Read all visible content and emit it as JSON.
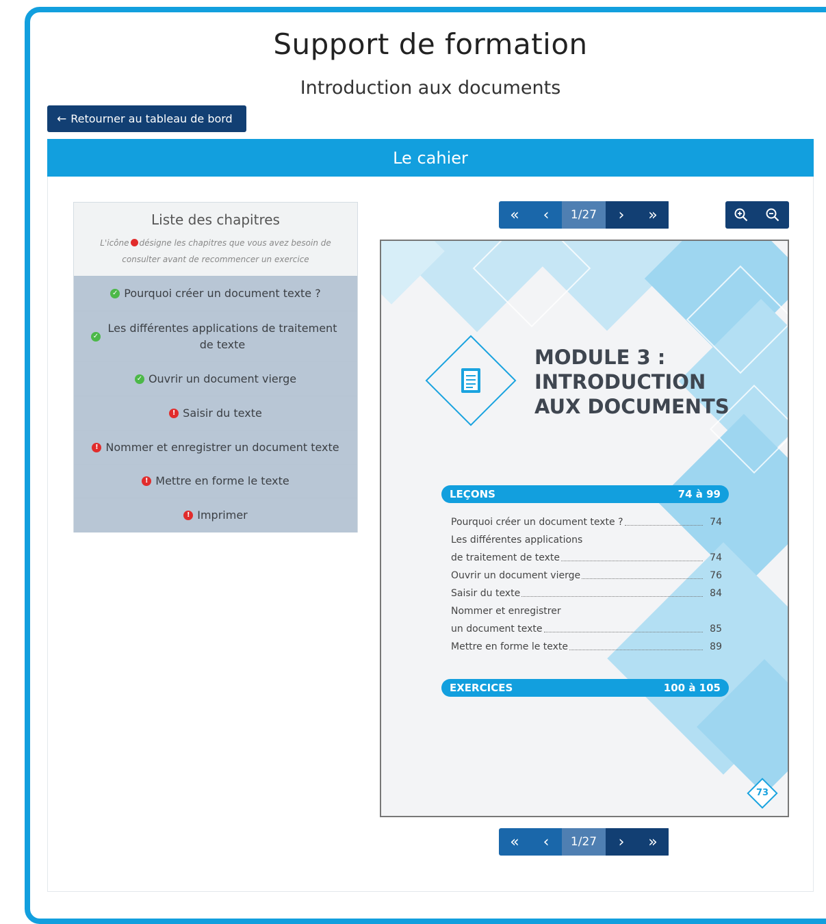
{
  "header": {
    "title": "Support de formation",
    "subtitle": "Introduction aux documents",
    "back_button": "Retourner au tableau de bord"
  },
  "panel": {
    "title": "Le cahier"
  },
  "chapters": {
    "title": "Liste des chapitres",
    "note_before": "L'icône",
    "note_after": "désigne les chapitres que vous avez besoin de consulter avant de recommencer un exercice",
    "items": [
      {
        "label": "Pourquoi créer un document texte ?",
        "status": "ok"
      },
      {
        "label": "Les différentes applications de traitement de texte",
        "status": "ok"
      },
      {
        "label": "Ouvrir un document vierge",
        "status": "ok"
      },
      {
        "label": "Saisir du texte",
        "status": "warn"
      },
      {
        "label": "Nommer et enregistrer un document texte",
        "status": "warn"
      },
      {
        "label": "Mettre en forme le texte",
        "status": "warn"
      },
      {
        "label": "Imprimer",
        "status": "warn"
      }
    ]
  },
  "pager": {
    "first": "«",
    "prev": "‹",
    "next": "›",
    "last": "»",
    "current": "1/27"
  },
  "zoom": {
    "in_icon": "zoom-in-icon",
    "out_icon": "zoom-out-icon"
  },
  "document_page": {
    "module_line1": "MODULE 3 :",
    "module_line2": "INTRODUCTION",
    "module_line3": "AUX DOCUMENTS",
    "lessons_label": "LEÇONS",
    "lessons_range": "74 à 99",
    "toc": [
      {
        "text": "Pourquoi créer un document texte ?",
        "page": "74"
      },
      {
        "text": "Les différentes applications",
        "page": ""
      },
      {
        "text": "de traitement de texte",
        "page": "74"
      },
      {
        "text": "Ouvrir un document vierge",
        "page": "76"
      },
      {
        "text": "Saisir du texte",
        "page": "84"
      },
      {
        "text": "Nommer et enregistrer",
        "page": ""
      },
      {
        "text": "un document texte",
        "page": "85"
      },
      {
        "text": "Mettre en forme le texte",
        "page": "89"
      }
    ],
    "exercises_label": "EXERCICES",
    "exercises_range": "100 à 105",
    "page_number": "73"
  },
  "colors": {
    "accent": "#129fde",
    "navy": "#123f73",
    "ok": "#4cb848",
    "warn": "#e12c2c"
  }
}
